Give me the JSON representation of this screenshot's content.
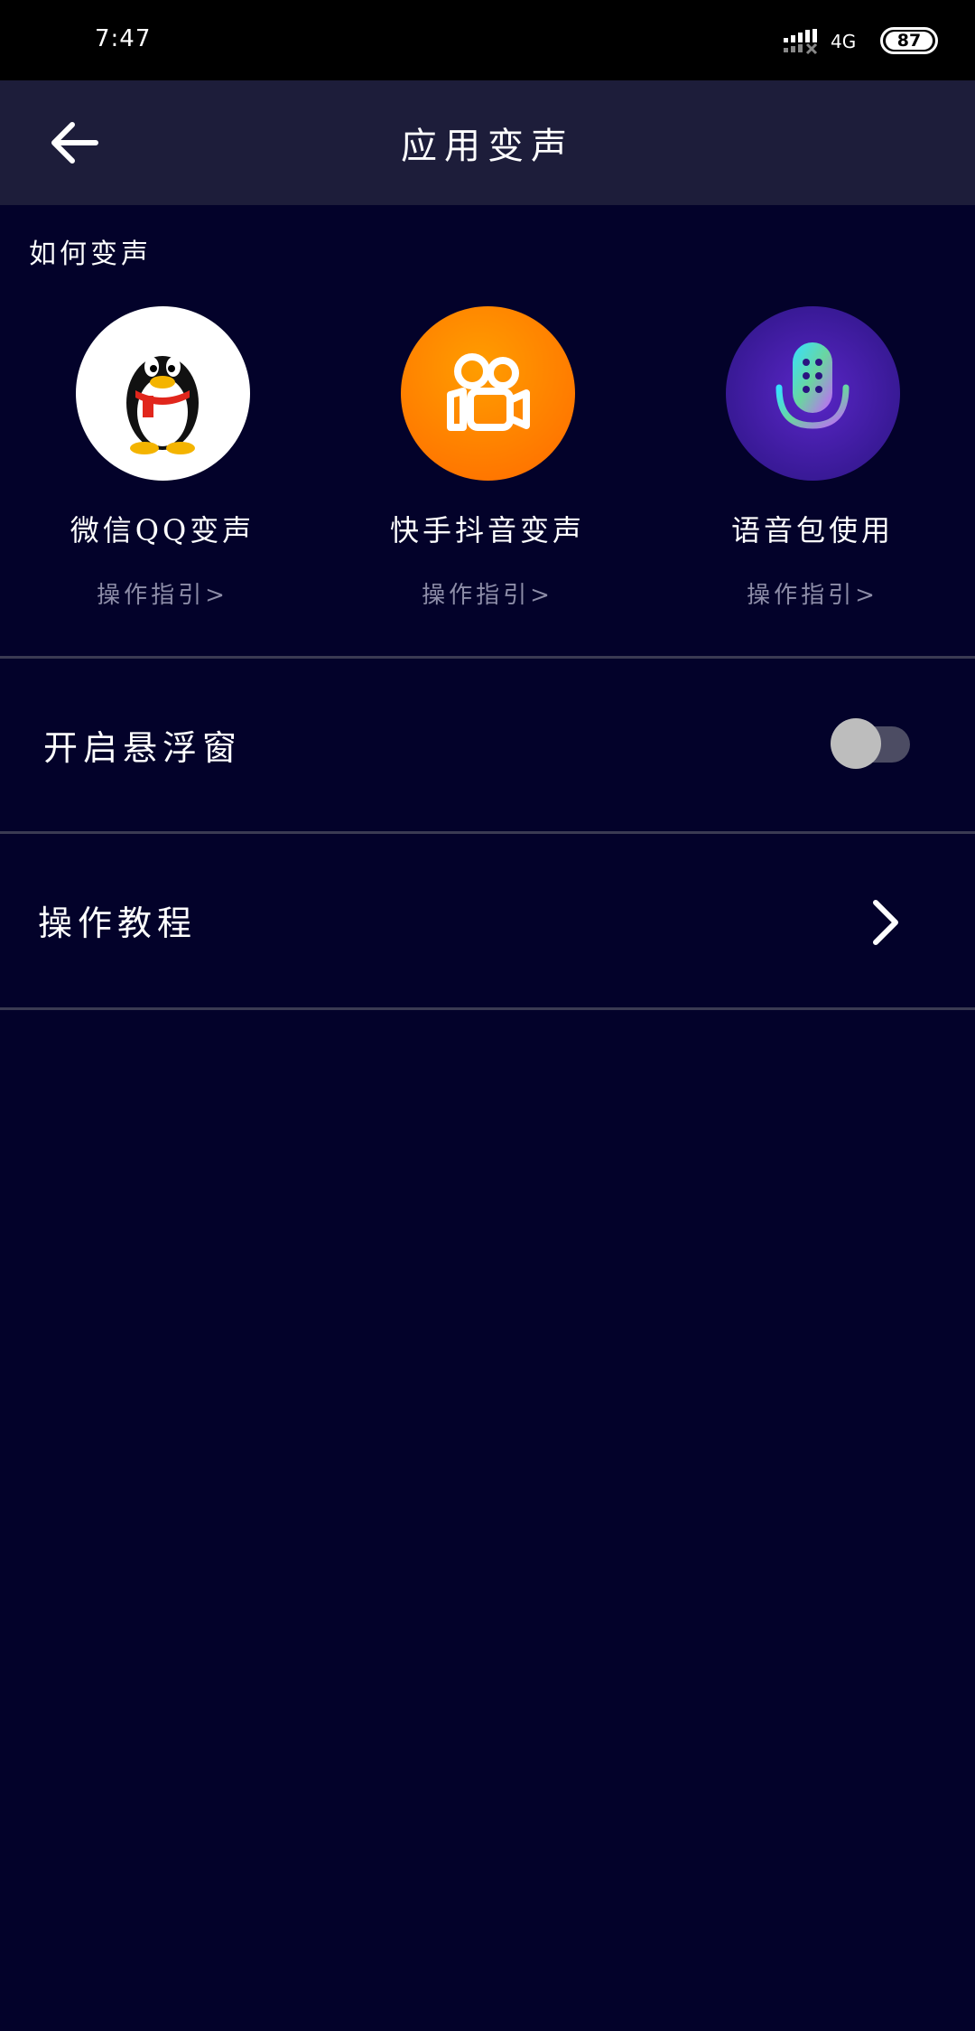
{
  "status_bar": {
    "time": "7:47",
    "network": "4G",
    "battery": "87"
  },
  "app_bar": {
    "title": "应用变声"
  },
  "how_to": {
    "label": "如何变声",
    "items": [
      {
        "name": "微信QQ变声",
        "guide": "操作指引>",
        "icon": "qq-penguin-icon"
      },
      {
        "name": "快手抖音变声",
        "guide": "操作指引>",
        "icon": "kuaishou-icon"
      },
      {
        "name": "语音包使用",
        "guide": "操作指引>",
        "icon": "microphone-icon"
      }
    ]
  },
  "floating_window": {
    "label": "开启悬浮窗",
    "enabled": false
  },
  "tutorial": {
    "label": "操作教程"
  },
  "colors": {
    "background": "#03022a",
    "app_bar": "#1d1d3a",
    "kuaishou_orange": "#ff7a00",
    "mic_purple": "#4a1fa8"
  }
}
